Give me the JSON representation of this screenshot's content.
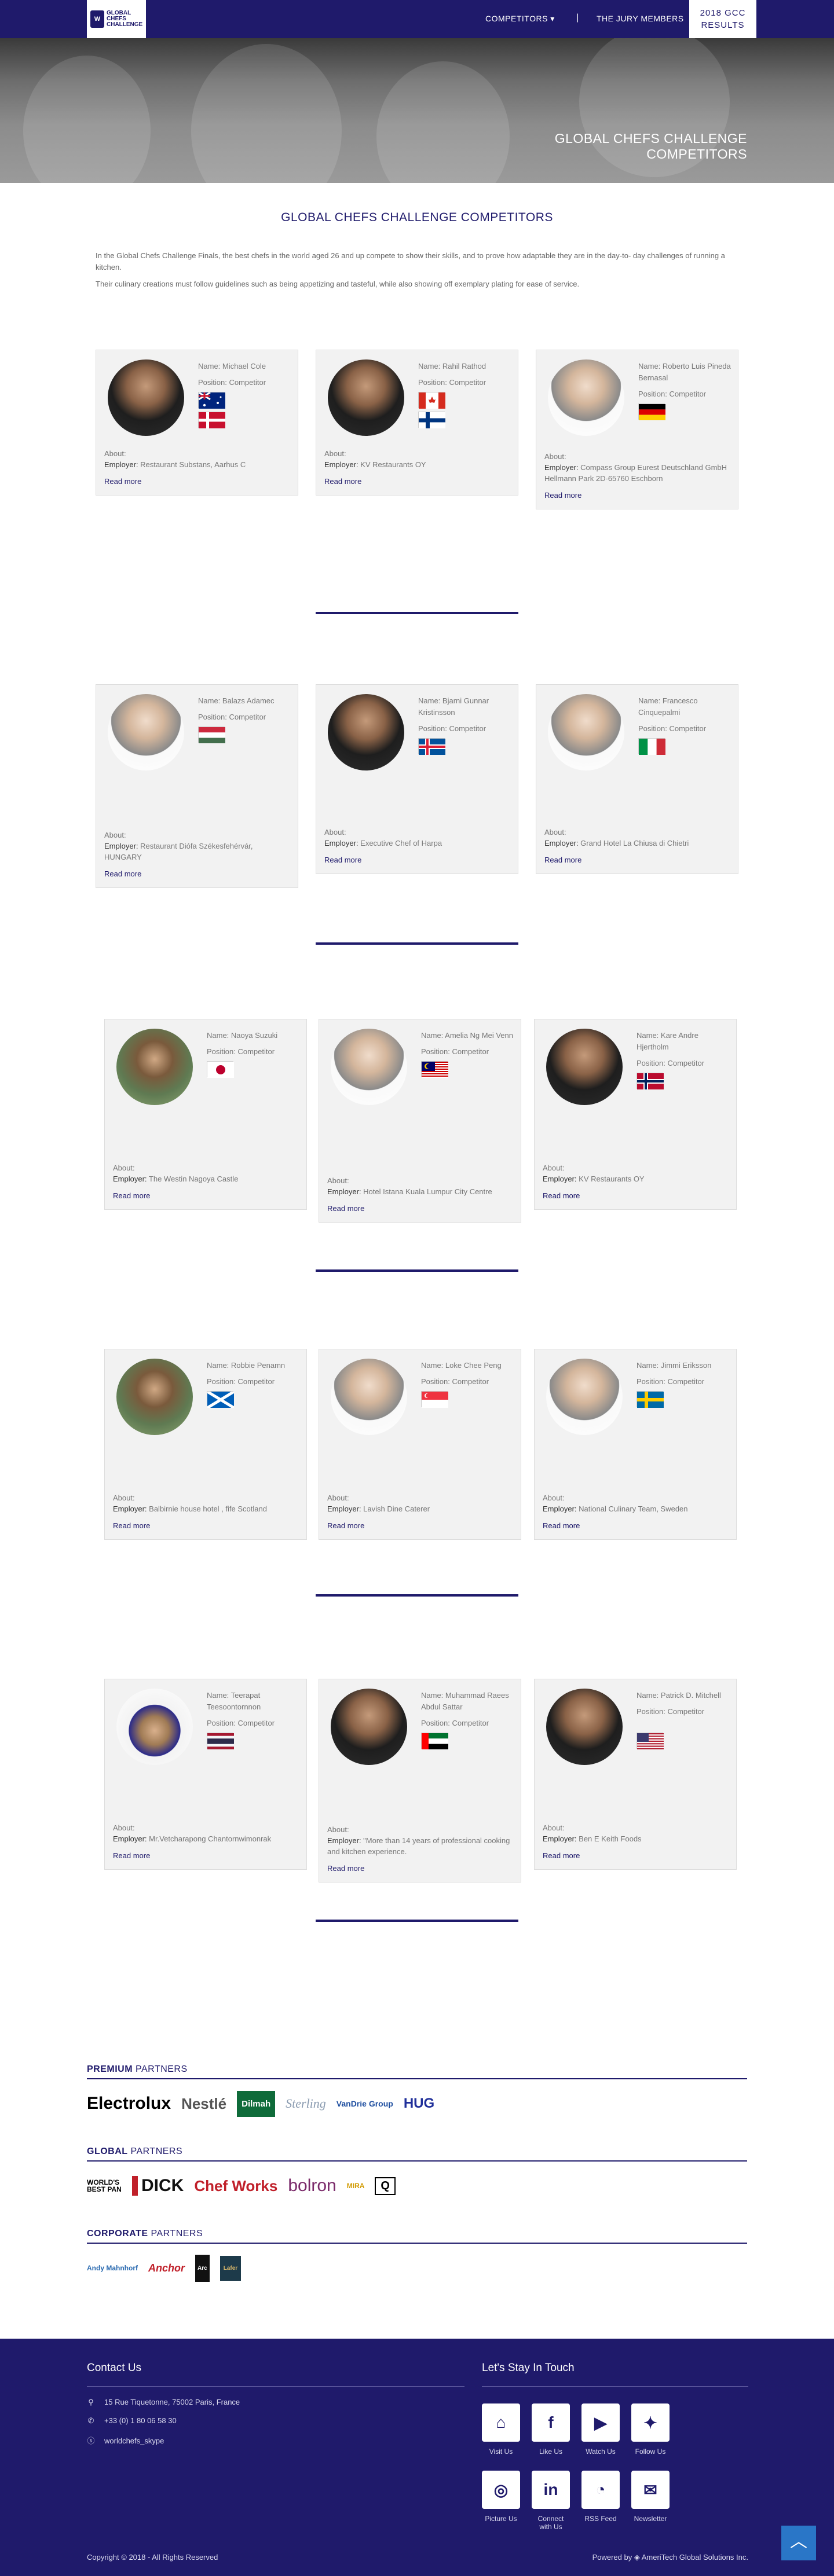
{
  "logo": {
    "mark": "W",
    "text": "GLOBAL\nCHEFS\nCHALLENGE"
  },
  "nav": {
    "competitors": "COMPETITORS ▾",
    "separator": "|",
    "jury": "THE JURY MEMBERS",
    "results": "2018 GCC\nRESULTS"
  },
  "hero": {
    "title": "GLOBAL CHEFS CHALLENGE COMPETITORS"
  },
  "page": {
    "title": "GLOBAL CHEFS CHALLENGE COMPETITORS",
    "intro1": "In the Global Chefs Challenge Finals, the best chefs in the world aged 26 and up compete to show their skills, and to prove how adaptable they are in the day-to- day challenges of running a kitchen.",
    "intro2": "Their culinary creations must follow guidelines such as being appetizing and tasteful, while also showing off exemplary plating for ease of service."
  },
  "labels": {
    "about": "About:",
    "employer": "Employer:",
    "read_more": "Read more"
  },
  "competitors": [
    {
      "name": "Name: Michael Cole",
      "position": "Position: Competitor",
      "employer": "Restaurant Substans, Aarhus C",
      "flags": [
        "australia",
        "denmark"
      ]
    },
    {
      "name": "Name: Rahil Rathod",
      "position": "Position: Competitor",
      "employer": "KV Restaurants OY",
      "flags": [
        "canada",
        "finland"
      ]
    },
    {
      "name": "Name: Roberto Luis Pineda Bernasal",
      "position": "Position: Competitor",
      "employer": "Compass Group Eurest Deutschland GmbH Hellmann Park 2D-65760 Eschborn",
      "flags": [
        "germany"
      ]
    },
    {
      "name": "Name: Balazs Adamec",
      "position": "Position: Competitor",
      "employer": "Restaurant Diófa Székesfehérvár, HUNGARY",
      "flags": [
        "hungary"
      ]
    },
    {
      "name": "Name: Bjarni Gunnar Kristinsson",
      "position": "Position: Competitor",
      "employer": "Executive Chef of Harpa",
      "flags": [
        "iceland"
      ]
    },
    {
      "name": "Name: Francesco Cinquepalmi",
      "position": "Position: Competitor",
      "employer": "Grand Hotel La Chiusa di Chietri",
      "flags": [
        "italy"
      ]
    },
    {
      "name": "Name: Naoya Suzuki",
      "position": "Position: Competitor",
      "employer": "The Westin Nagoya Castle",
      "flags": [
        "japan"
      ]
    },
    {
      "name": "Name: Amelia Ng Mei Venn",
      "position": "Position: Competitor",
      "employer": "Hotel Istana Kuala Lumpur City Centre",
      "flags": [
        "malaysia"
      ]
    },
    {
      "name": "Name: Kare Andre Hjertholm",
      "position": "Position: Competitor",
      "employer": "KV Restaurants OY",
      "flags": [
        "norway"
      ]
    },
    {
      "name": "Name: Robbie Penamn",
      "position": "Position: Competitor",
      "employer": "Balbirnie house hotel , fife Scotland",
      "flags": [
        "scotland"
      ]
    },
    {
      "name": "Name: Loke Chee Peng",
      "position": "Position: Competitor",
      "employer": "Lavish Dine Caterer",
      "flags": [
        "singapore"
      ]
    },
    {
      "name": "Name: Jimmi Eriksson",
      "position": "Position: Competitor",
      "employer": "National Culinary Team, Sweden",
      "flags": [
        "sweden"
      ]
    },
    {
      "name": "Name: Teerapat Teesoontornnon",
      "position": "Position: Competitor",
      "employer": "Mr.Vetcharapong Chantornwimonrak",
      "flags": [
        "thailand"
      ]
    },
    {
      "name": "Name: Muhammad Raees Abdul Sattar",
      "position": "Position: Competitor",
      "employer": "\"More than 14 years of professional cooking and kitchen experience.",
      "flags": [
        "uae"
      ]
    },
    {
      "name": "Name: Patrick D. Mitchell",
      "position": "Position: Competitor",
      "employer": "Ben E Keith Foods",
      "flags": [
        "usa"
      ]
    }
  ],
  "partners": {
    "premium": {
      "strong": "PREMIUM",
      "rest": " PARTNERS",
      "logos": [
        "Electrolux",
        "Nestlé",
        "Dilmah",
        "Sterling",
        "VanDrie Group",
        "HUG"
      ]
    },
    "global": {
      "strong": "GLOBAL",
      "rest": " PARTNERS",
      "logos": [
        "WORLD'S BEST PAN",
        "DICK",
        "Chef Works",
        "bolron",
        "MIRA",
        "Q"
      ]
    },
    "corporate": {
      "strong": "CORPORATE",
      "rest": " PARTNERS",
      "logos": [
        "Andy Mahnhorf",
        "Anchor",
        "Arc",
        "Lafer"
      ]
    }
  },
  "footer": {
    "contact_title": "Contact Us",
    "address": "15 Rue Tiquetonne, 75002 Paris, France",
    "phone": "+33 (0) 1 80 06 58 30",
    "skype": "worldchefs_skype",
    "stay_title": "Let's Stay In Touch",
    "social": [
      {
        "label": "Visit Us",
        "icon": "home-icon"
      },
      {
        "label": "Like Us",
        "icon": "facebook-icon"
      },
      {
        "label": "Watch Us",
        "icon": "youtube-icon"
      },
      {
        "label": "Follow Us",
        "icon": "twitter-icon"
      },
      {
        "label": "Picture Us",
        "icon": "instagram-icon"
      },
      {
        "label": "Connect with Us",
        "icon": "linkedin-icon"
      },
      {
        "label": "RSS Feed",
        "icon": "rss-icon"
      },
      {
        "label": "Newsletter",
        "icon": "newsletter-icon"
      }
    ],
    "copyright": "Copyright © 2018 - All Rights Reserved",
    "powered": "Powered by ◈ AmeriTech Global Solutions Inc."
  },
  "colors": {
    "brand": "#1f1a6b",
    "totop": "#2a76c7"
  }
}
